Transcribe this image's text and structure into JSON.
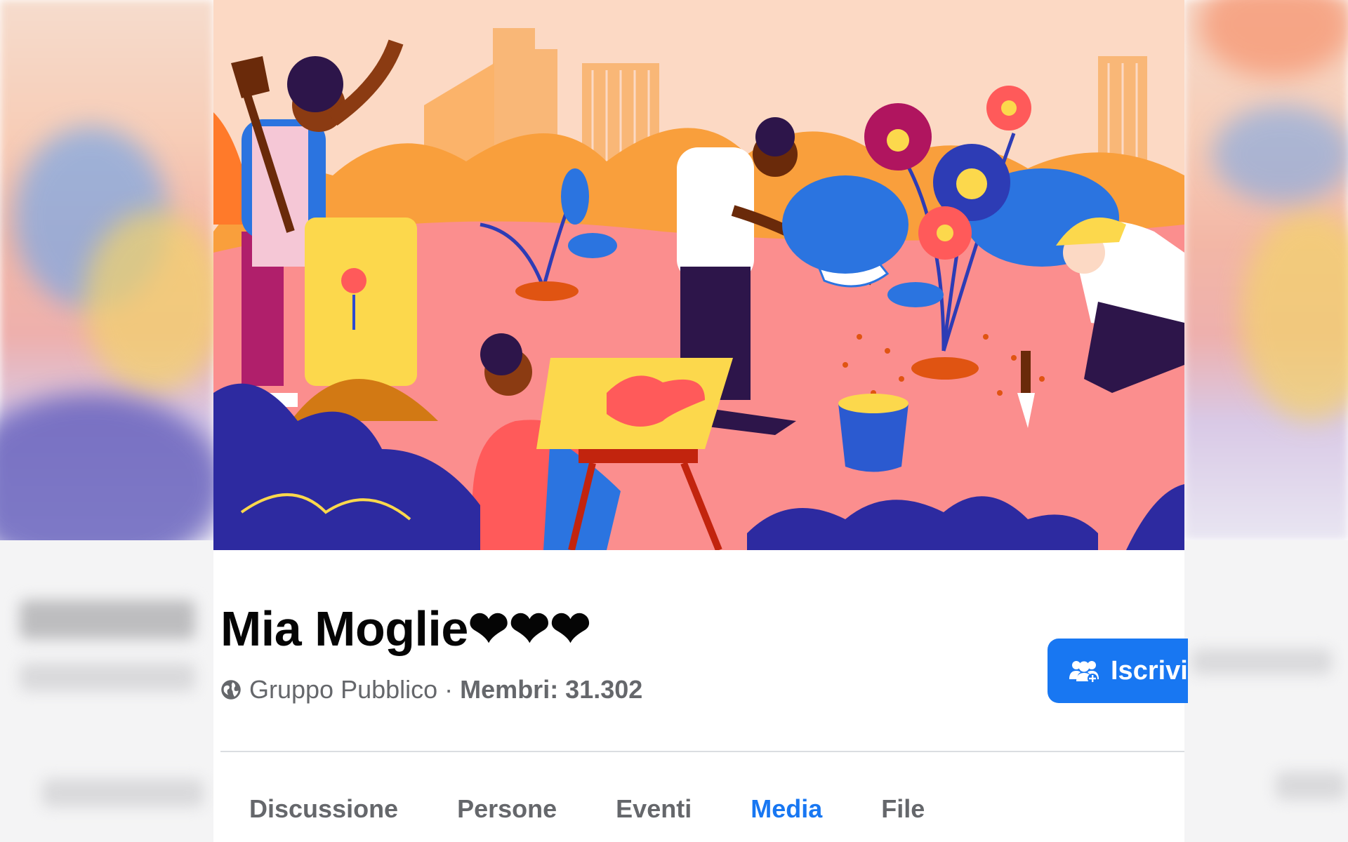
{
  "group": {
    "name": "Mia Moglie❤❤❤",
    "privacy": "Gruppo Pubblico",
    "separator": "·",
    "members": "Membri: 31.302"
  },
  "actions": {
    "join_label": "Iscrivi",
    "join_icon": "people-plus-icon"
  },
  "tabs": [
    {
      "label": "Discussione",
      "active": false
    },
    {
      "label": "Persone",
      "active": false
    },
    {
      "label": "Eventi",
      "active": false
    },
    {
      "label": "Media",
      "active": true
    },
    {
      "label": "File",
      "active": false
    }
  ],
  "icons": {
    "privacy_icon": "globe-icon"
  },
  "colors": {
    "accent": "#1877f2",
    "title": "#050505",
    "secondary_text": "#65676b",
    "divider": "#dadde1"
  }
}
